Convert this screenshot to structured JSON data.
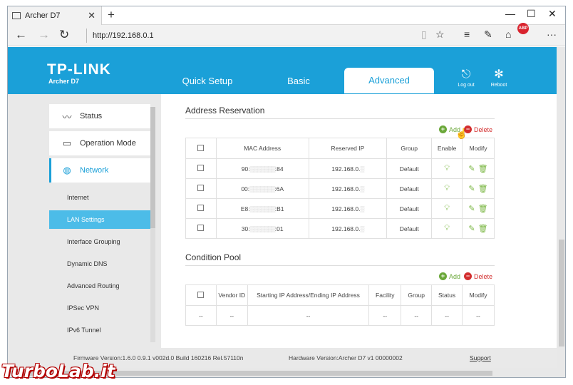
{
  "browser": {
    "tab_title": "Archer D7",
    "tab_close": "✕",
    "new_tab": "+",
    "window_controls": {
      "minimize": "—",
      "maximize": "☐",
      "close": "✕"
    },
    "url": "http://192.168.0.1",
    "icons": [
      "back-icon",
      "forward-icon",
      "refresh-icon",
      "reading-view-icon",
      "favorite-star-icon",
      "hub-icon",
      "web-note-icon",
      "share-icon",
      "adblock-icon",
      "more-icon"
    ],
    "adblock_label": "ABP",
    "more_label": "···"
  },
  "header": {
    "logo": "TP-LINK",
    "model": "Archer D7",
    "tabs": [
      {
        "label": "Quick Setup",
        "active": false
      },
      {
        "label": "Basic",
        "active": false
      },
      {
        "label": "Advanced",
        "active": true
      }
    ],
    "logout_label": "Log out",
    "reboot_label": "Reboot"
  },
  "sidebar": {
    "main_items": [
      {
        "label": "Status",
        "icon": "pulse-icon",
        "active": false
      },
      {
        "label": "Operation Mode",
        "icon": "monitor-icon",
        "active": false
      },
      {
        "label": "Network",
        "icon": "globe-icon",
        "active": true
      }
    ],
    "sub_items": [
      {
        "label": "Internet",
        "active": false
      },
      {
        "label": "LAN Settings",
        "active": true
      },
      {
        "label": "Interface Grouping",
        "active": false
      },
      {
        "label": "Dynamic DNS",
        "active": false
      },
      {
        "label": "Advanced Routing",
        "active": false
      },
      {
        "label": "IPSec VPN",
        "active": false
      },
      {
        "label": "IPv6 Tunnel",
        "active": false
      }
    ]
  },
  "address_reservation": {
    "title": "Address Reservation",
    "add_label": "Add",
    "delete_label": "Delete",
    "columns": [
      "MAC Address",
      "Reserved IP",
      "Group",
      "Enable",
      "Modify"
    ],
    "rows": [
      {
        "mac_start": "90:",
        "mac_end": ":84",
        "ip": "192.168.0.",
        "group": "Default"
      },
      {
        "mac_start": "00:",
        "mac_end": ":6A",
        "ip": "192.168.0.",
        "group": "Default"
      },
      {
        "mac_start": "E8:",
        "mac_end": ":B1",
        "ip": "192.168.0.",
        "group": "Default"
      },
      {
        "mac_start": "30:",
        "mac_end": ":01",
        "ip": "192.168.0.",
        "group": "Default"
      }
    ]
  },
  "condition_pool": {
    "title": "Condition Pool",
    "add_label": "Add",
    "delete_label": "Delete",
    "columns": [
      "Vendor ID",
      "Starting IP Address/Ending IP Address",
      "Facility",
      "Group",
      "Status",
      "Modify"
    ],
    "empty_cell": "--"
  },
  "footer": {
    "firmware": "Firmware Version:1.6.0 0.9.1 v002d.0 Build 160216 Rel.57110n",
    "hardware": "Hardware Version:Archer D7 v1 00000002",
    "support": "Support"
  },
  "watermark": "TurboLab.it",
  "colors": {
    "accent": "#1ba0d8",
    "active_sub": "#4cbce8",
    "add": "#6ba83a",
    "delete": "#d32f2f"
  }
}
